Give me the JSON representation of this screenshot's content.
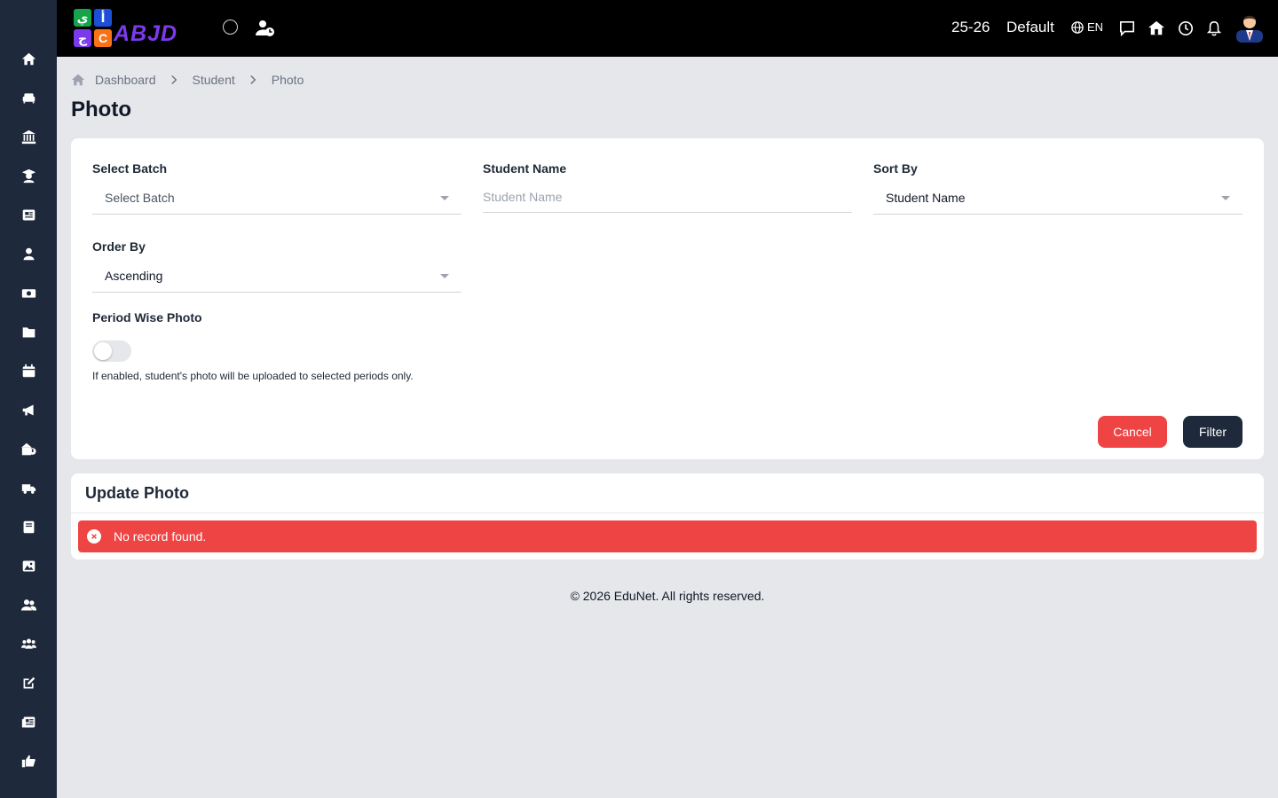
{
  "colors": {
    "sidebar": "#1e293b",
    "topbar": "#000000",
    "page_bg": "#e5e7eb",
    "cancel": "#ef4444",
    "filter": "#1e293b",
    "alert": "#ef4444"
  },
  "sidebar": {
    "items": [
      {
        "icon": "home-icon"
      },
      {
        "icon": "sofa-icon"
      },
      {
        "icon": "bank-icon"
      },
      {
        "icon": "graduate-icon"
      },
      {
        "icon": "newspaper-icon"
      },
      {
        "icon": "teacher-icon"
      },
      {
        "icon": "money-icon"
      },
      {
        "icon": "folder-icon"
      },
      {
        "icon": "calendar-icon"
      },
      {
        "icon": "megaphone-icon"
      },
      {
        "icon": "school-icon"
      },
      {
        "icon": "truck-icon"
      },
      {
        "icon": "book-icon"
      },
      {
        "icon": "image-icon"
      },
      {
        "icon": "users-icon"
      },
      {
        "icon": "group-icon"
      },
      {
        "icon": "edit-icon"
      },
      {
        "icon": "news-icon"
      },
      {
        "icon": "thumbs-up-icon"
      }
    ]
  },
  "topbar": {
    "logo": {
      "tiles": [
        "ي",
        "أ",
        "ج",
        "C"
      ],
      "text": "ABJD"
    },
    "session": "25-26",
    "profile": "Default",
    "language": "EN"
  },
  "breadcrumb": {
    "items": [
      "Dashboard",
      "Student",
      "Photo"
    ]
  },
  "page": {
    "title": "Photo"
  },
  "filter_form": {
    "batch": {
      "label": "Select Batch",
      "value": "Select Batch"
    },
    "student_name": {
      "label": "Student Name",
      "placeholder": "Student Name",
      "value": ""
    },
    "sort_by": {
      "label": "Sort By",
      "value": "Student Name"
    },
    "order_by": {
      "label": "Order By",
      "value": "Ascending"
    },
    "period_wise": {
      "label": "Period Wise Photo",
      "enabled": false,
      "help": "If enabled, student's photo will be uploaded to selected periods only."
    },
    "cancel_label": "Cancel",
    "filter_label": "Filter"
  },
  "update_photo": {
    "title": "Update Photo",
    "alert": "No record found."
  },
  "footer": {
    "text": "© 2026 EduNet. All rights reserved."
  }
}
